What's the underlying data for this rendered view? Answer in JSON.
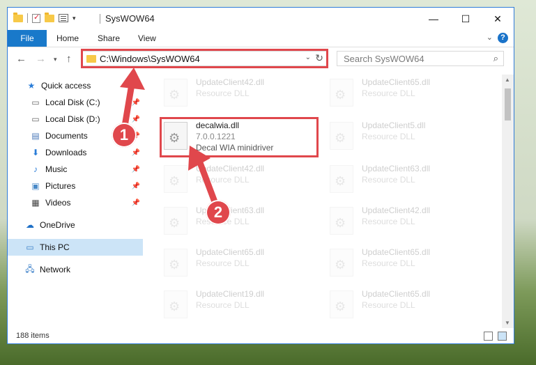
{
  "window": {
    "title": "SysWOW64"
  },
  "ribbon": {
    "file": "File",
    "home": "Home",
    "share": "Share",
    "view": "View"
  },
  "address": {
    "path": "C:\\Windows\\SysWOW64"
  },
  "search": {
    "placeholder": "Search SysWOW64"
  },
  "nav": [
    {
      "label": "Quick access"
    },
    {
      "label": "Local Disk (C:)"
    },
    {
      "label": "Local Disk (D:)"
    },
    {
      "label": "Documents"
    },
    {
      "label": "Downloads"
    },
    {
      "label": "Music"
    },
    {
      "label": "Pictures"
    },
    {
      "label": "Videos"
    },
    {
      "label": "OneDrive"
    },
    {
      "label": "This PC"
    },
    {
      "label": "Network"
    }
  ],
  "files": {
    "selected": {
      "name": "decalwia.dll",
      "version": "7.0.0.1221",
      "desc": "Decal WIA minidriver"
    },
    "left": [
      {
        "name": "UpdateClient42.dll",
        "type": "Resource DLL"
      },
      {
        "name": "UpdateClient42.dll",
        "type": "Resource DLL"
      },
      {
        "name": "UpdateClient63.dll",
        "type": "Resource DLL"
      },
      {
        "name": "UpdateClient65.dll",
        "type": "Resource DLL"
      },
      {
        "name": "UpdateClient19.dll",
        "type": "Resource DLL"
      }
    ],
    "right": [
      {
        "name": "UpdateClient65.dll",
        "type": "Resource DLL"
      },
      {
        "name": "UpdateClient5.dll",
        "type": "Resource DLL"
      },
      {
        "name": "UpdateClient63.dll",
        "type": "Resource DLL"
      },
      {
        "name": "UpdateClient42.dll",
        "type": "Resource DLL"
      },
      {
        "name": "UpdateClient65.dll",
        "type": "Resource DLL"
      },
      {
        "name": "UpdateClient65.dll",
        "type": "Resource DLL"
      }
    ]
  },
  "status": {
    "count": "188 items"
  },
  "callouts": {
    "one": "1",
    "two": "2"
  },
  "colors": {
    "highlight": "#e0474c",
    "accent": "#1979ca"
  }
}
